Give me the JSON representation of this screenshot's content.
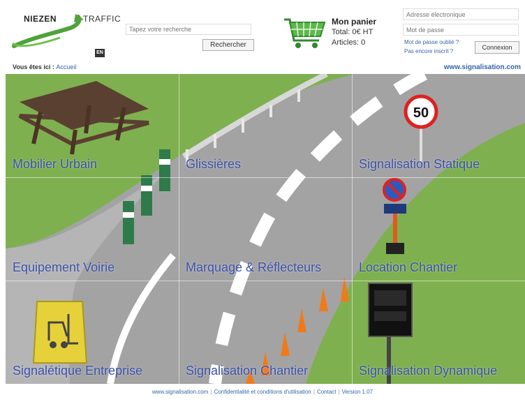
{
  "header": {
    "logo_left": "NIEZEN",
    "logo_right": "TRAFFIC",
    "lang": "EN",
    "search_placeholder": "Tapez votre recherche",
    "search_button": "Rechercher",
    "cart": {
      "title": "Mon panier",
      "total": "Total: 0€ HT",
      "articles": "Articles: 0"
    },
    "login": {
      "email_placeholder": "Adresse électronique",
      "password_placeholder": "Mot de passe",
      "forgot": "Mot de passe oublié ?",
      "register": "Pas encore inscrit ?",
      "button": "Connexion"
    }
  },
  "breadcrumb": {
    "prefix": "Vous êtes ici :",
    "home": "Accueil",
    "site": "www.signalisation.com"
  },
  "categories": [
    {
      "label": "Mobilier Urbain"
    },
    {
      "label": "Glissières"
    },
    {
      "label": "Signalisation Statique"
    },
    {
      "label": "Equipement Voirie"
    },
    {
      "label": "Marquage & Réflecteurs"
    },
    {
      "label": "Location Chantier"
    },
    {
      "label": "Signalétique Entreprise"
    },
    {
      "label": "Signalisation Chantier"
    },
    {
      "label": "Signalisation Dynamique"
    }
  ],
  "scene": {
    "speed_sign": "50"
  },
  "footer": {
    "site": "www.signalisation.com",
    "terms": "Confidentialité et conditions d'utilisation",
    "contact": "Contact",
    "version": "Version 1.07"
  },
  "colors": {
    "grass": "#7fb050",
    "road": "#9a9a9a",
    "label": "#3a4fa8",
    "link": "#3366aa"
  }
}
